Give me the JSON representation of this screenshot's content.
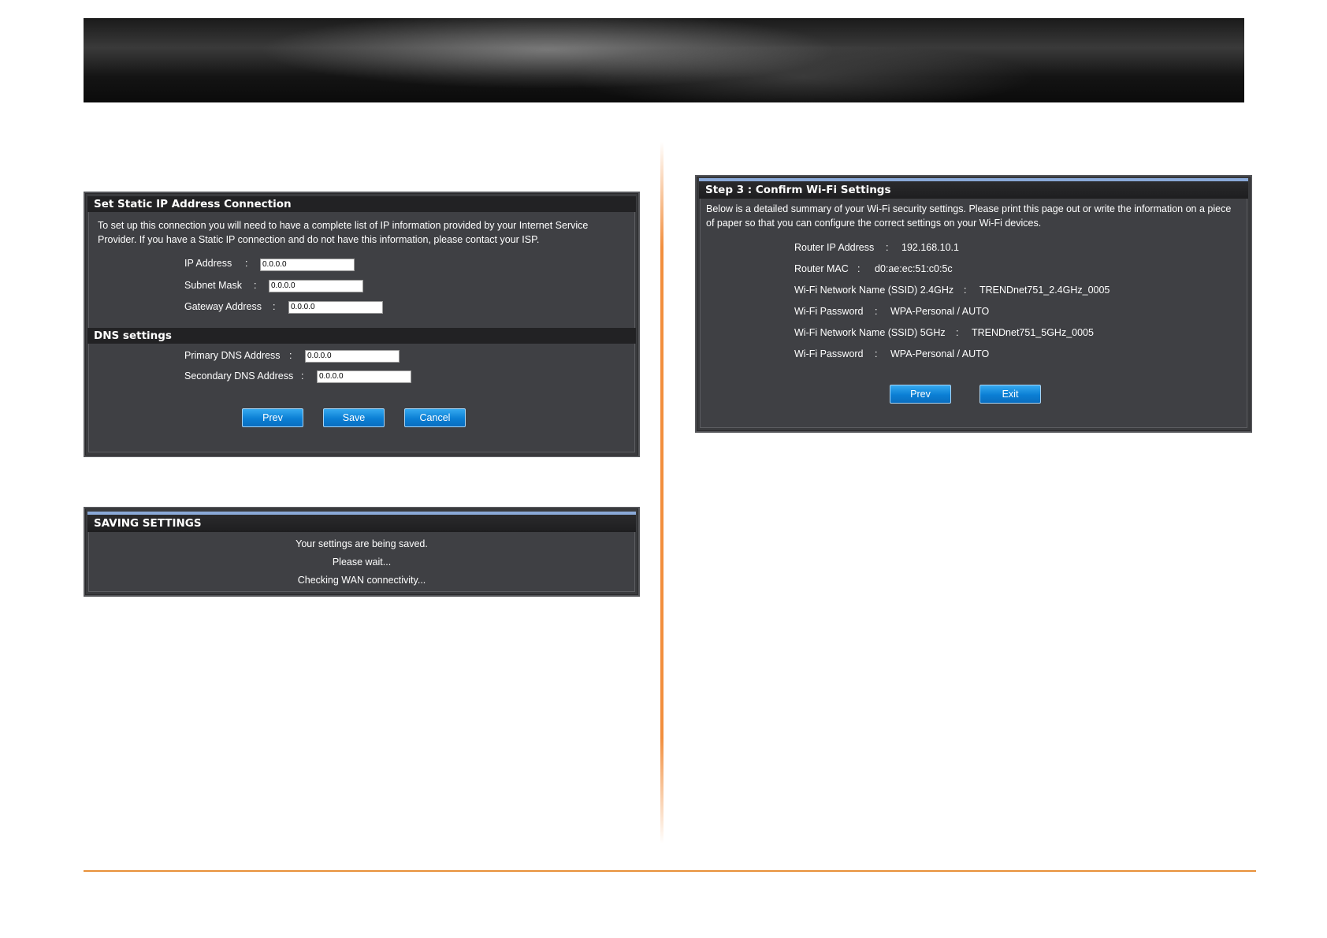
{
  "static_ip_panel": {
    "title": "Set Static IP Address Connection",
    "description": "To set up this connection you will need to have a complete list of IP information provided by your Internet Service Provider. If you have a Static IP connection and do not have this information, please contact your ISP.",
    "ip_address_label": "IP Address",
    "ip_address_value": "0.0.0.0",
    "subnet_mask_label": "Subnet Mask",
    "subnet_mask_value": "0.0.0.0",
    "gateway_label": "Gateway Address",
    "gateway_value": "0.0.0.0",
    "separator": ":",
    "dns_title": "DNS settings",
    "primary_dns_label": "Primary DNS Address",
    "primary_dns_value": "0.0.0.0",
    "secondary_dns_label": "Secondary DNS Address",
    "secondary_dns_value": "0.0.0.0",
    "prev_label": "Prev",
    "save_label": "Save",
    "cancel_label": "Cancel"
  },
  "saving_panel": {
    "title": "SAVING SETTINGS",
    "line1": "Your settings are being saved.",
    "line2": "Please wait...",
    "line3": "Checking WAN connectivity..."
  },
  "confirm_panel": {
    "title": "Step 3 : Confirm Wi-Fi Settings",
    "description": "Below is a detailed summary of your Wi-Fi security settings. Please print this page out or write the information on a piece of paper so that you can configure the correct settings on your Wi-Fi devices.",
    "rows": [
      {
        "label": "Router IP Address",
        "sep": ":",
        "value": "192.168.10.1"
      },
      {
        "label": "Router MAC",
        "sep": ":",
        "value": "d0:ae:ec:51:c0:5c"
      },
      {
        "label": "Wi-Fi Network Name (SSID) 2.4GHz",
        "sep": ":",
        "value": "TRENDnet751_2.4GHz_0005"
      },
      {
        "label": "Wi-Fi Password",
        "sep": ":",
        "value": "WPA-Personal / AUTO"
      },
      {
        "label": "Wi-Fi Network Name (SSID) 5GHz",
        "sep": ":",
        "value": "TRENDnet751_5GHz_0005"
      },
      {
        "label": "Wi-Fi Password",
        "sep": ":",
        "value": "WPA-Personal / AUTO"
      }
    ],
    "prev_label": "Prev",
    "exit_label": "Exit"
  }
}
